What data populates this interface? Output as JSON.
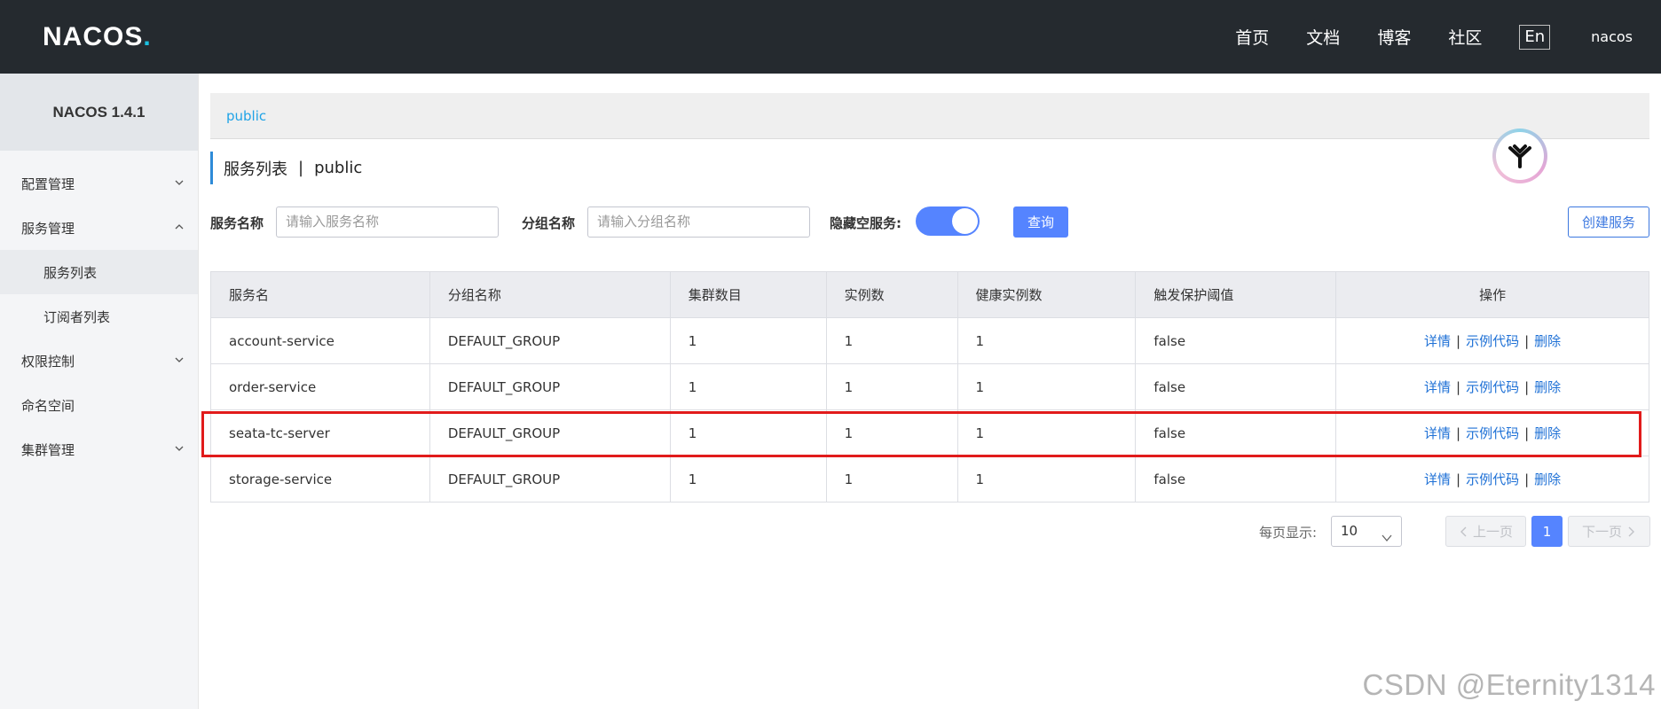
{
  "header": {
    "logo_text_a": "NA",
    "logo_text_b": "C",
    "logo_text_c": "OS",
    "logo_dot": ".",
    "nav": [
      "首页",
      "文档",
      "博客",
      "社区"
    ],
    "lang": "En",
    "user": "nacos"
  },
  "sidebar": {
    "version": "NACOS 1.4.1",
    "items": [
      {
        "label": "配置管理"
      },
      {
        "label": "服务管理"
      },
      {
        "label": "服务列表"
      },
      {
        "label": "订阅者列表"
      },
      {
        "label": "权限控制"
      },
      {
        "label": "命名空间"
      },
      {
        "label": "集群管理"
      }
    ]
  },
  "namespace": {
    "current": "public"
  },
  "title": {
    "main": "服务列表",
    "sep": "|",
    "namespace": "public"
  },
  "filters": {
    "service_name_label": "服务名称",
    "service_name_placeholder": "请输入服务名称",
    "group_name_label": "分组名称",
    "group_name_placeholder": "请输入分组名称",
    "hide_empty_label": "隐藏空服务:",
    "hide_empty_on": true,
    "query_label": "查询",
    "create_label": "创建服务"
  },
  "table": {
    "headers": [
      "服务名",
      "分组名称",
      "集群数目",
      "实例数",
      "健康实例数",
      "触发保护阈值",
      "操作"
    ],
    "actions": {
      "detail": "详情",
      "sample": "示例代码",
      "delete": "删除",
      "sep": "|"
    },
    "rows": [
      {
        "name": "account-service",
        "group": "DEFAULT_GROUP",
        "clusters": "1",
        "instances": "1",
        "healthy": "1",
        "threshold": "false"
      },
      {
        "name": "order-service",
        "group": "DEFAULT_GROUP",
        "clusters": "1",
        "instances": "1",
        "healthy": "1",
        "threshold": "false"
      },
      {
        "name": "seata-tc-server",
        "group": "DEFAULT_GROUP",
        "clusters": "1",
        "instances": "1",
        "healthy": "1",
        "threshold": "false"
      },
      {
        "name": "storage-service",
        "group": "DEFAULT_GROUP",
        "clusters": "1",
        "instances": "1",
        "healthy": "1",
        "threshold": "false"
      }
    ]
  },
  "pagination": {
    "page_size_label": "每页显示:",
    "page_size": "10",
    "prev": "上一页",
    "current": "1",
    "next": "下一页"
  },
  "watermark": "CSDN @Eternity1314",
  "colors": {
    "primary": "#5584ff",
    "link": "#1f71d6",
    "highlight": "#e11b1b",
    "header_bg": "#252a2f"
  }
}
